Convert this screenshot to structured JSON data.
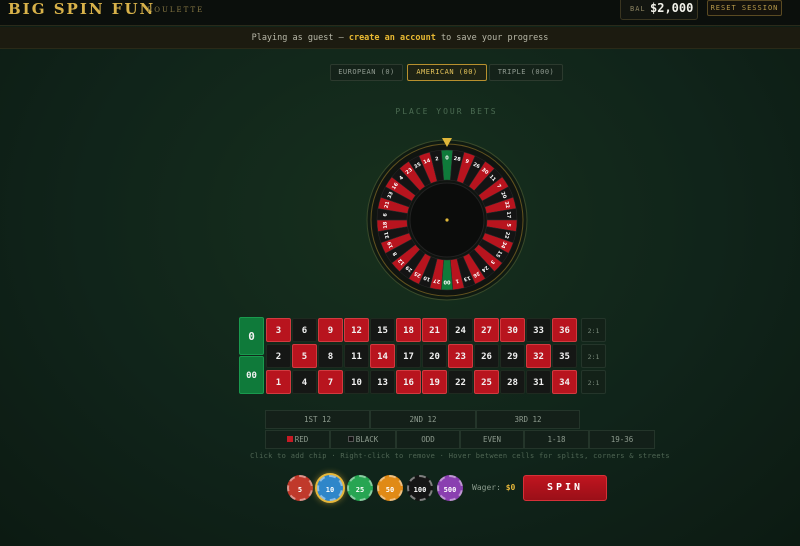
{
  "header": {
    "title": "BIG SPIN FUN",
    "subtitle": "ROULETTE",
    "balance_label": "BAL",
    "balance": "$2,000",
    "reset_label": "RESET SESSION"
  },
  "guest": {
    "prefix": "Playing as guest —",
    "link": "create an account",
    "suffix": "to save your progress"
  },
  "variants": [
    {
      "label": "EUROPEAN (0)",
      "active": false
    },
    {
      "label": "AMERICAN (00)",
      "active": true
    },
    {
      "label": "TRIPLE (000)",
      "active": false
    }
  ],
  "status": "PLACE YOUR BETS",
  "wheel": {
    "sequence": [
      "0",
      "28",
      "9",
      "26",
      "30",
      "11",
      "7",
      "20",
      "32",
      "17",
      "5",
      "22",
      "34",
      "15",
      "3",
      "24",
      "36",
      "13",
      "1",
      "00",
      "27",
      "10",
      "25",
      "29",
      "12",
      "8",
      "19",
      "31",
      "18",
      "6",
      "21",
      "33",
      "16",
      "4",
      "23",
      "35",
      "14",
      "2"
    ],
    "colors": {
      "red": "#b8141e",
      "black": "#141414",
      "green": "#0f7a3a",
      "gold": "#b8902e"
    }
  },
  "table": {
    "zeros": [
      "0",
      "00"
    ],
    "rows": [
      [
        {
          "n": "3",
          "c": "red"
        },
        {
          "n": "6",
          "c": "black"
        },
        {
          "n": "9",
          "c": "red"
        },
        {
          "n": "12",
          "c": "red"
        },
        {
          "n": "15",
          "c": "black"
        },
        {
          "n": "18",
          "c": "red"
        },
        {
          "n": "21",
          "c": "red"
        },
        {
          "n": "24",
          "c": "black"
        },
        {
          "n": "27",
          "c": "red"
        },
        {
          "n": "30",
          "c": "red"
        },
        {
          "n": "33",
          "c": "black"
        },
        {
          "n": "36",
          "c": "red"
        }
      ],
      [
        {
          "n": "2",
          "c": "black"
        },
        {
          "n": "5",
          "c": "red"
        },
        {
          "n": "8",
          "c": "black"
        },
        {
          "n": "11",
          "c": "black"
        },
        {
          "n": "14",
          "c": "red"
        },
        {
          "n": "17",
          "c": "black"
        },
        {
          "n": "20",
          "c": "black"
        },
        {
          "n": "23",
          "c": "red"
        },
        {
          "n": "26",
          "c": "black"
        },
        {
          "n": "29",
          "c": "black"
        },
        {
          "n": "32",
          "c": "red"
        },
        {
          "n": "35",
          "c": "black"
        }
      ],
      [
        {
          "n": "1",
          "c": "red"
        },
        {
          "n": "4",
          "c": "black"
        },
        {
          "n": "7",
          "c": "red"
        },
        {
          "n": "10",
          "c": "black"
        },
        {
          "n": "13",
          "c": "black"
        },
        {
          "n": "16",
          "c": "red"
        },
        {
          "n": "19",
          "c": "red"
        },
        {
          "n": "22",
          "c": "black"
        },
        {
          "n": "25",
          "c": "red"
        },
        {
          "n": "28",
          "c": "black"
        },
        {
          "n": "31",
          "c": "black"
        },
        {
          "n": "34",
          "c": "red"
        }
      ]
    ],
    "col_bets": [
      "2:1",
      "2:1",
      "2:1"
    ],
    "dozens": [
      "1ST 12",
      "2ND 12",
      "3RD 12"
    ],
    "outside": {
      "red": "RED",
      "black": "BLACK",
      "odd": "ODD",
      "even": "EVEN",
      "low": "1-18",
      "high": "19-36"
    }
  },
  "hint": "Click to add chip · Right-click to remove · Hover between cells for splits, corners & streets",
  "chips": [
    {
      "value": "5",
      "color": "#c0392b",
      "selected": false
    },
    {
      "value": "10",
      "color": "#2f86c9",
      "selected": true
    },
    {
      "value": "25",
      "color": "#27a552",
      "selected": false
    },
    {
      "value": "50",
      "color": "#e08a16",
      "selected": false
    },
    {
      "value": "100",
      "color": "#151515",
      "selected": false
    },
    {
      "value": "500",
      "color": "#8a3fb0",
      "selected": false
    }
  ],
  "wager": {
    "label": "Wager:",
    "amount": "$0"
  },
  "spin_label": "SPIN"
}
